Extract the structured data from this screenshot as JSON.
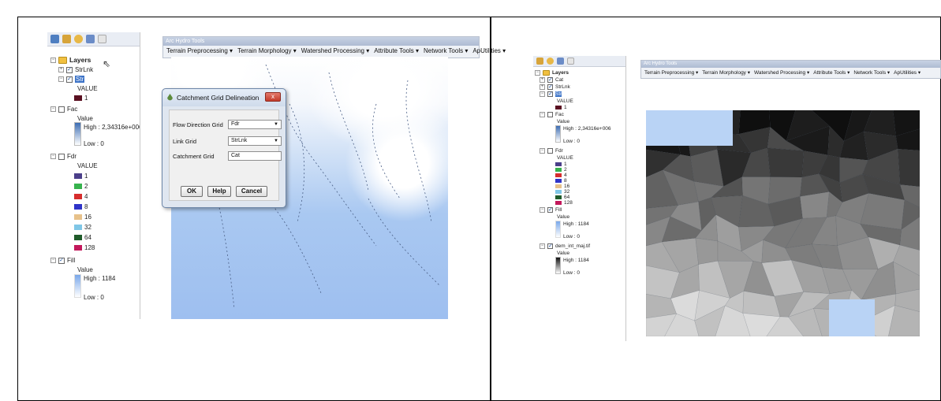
{
  "left": {
    "toc": {
      "root_label": "Layers",
      "layers": [
        {
          "name": "StrLnk",
          "checked": true
        },
        {
          "name": "Str",
          "checked": true,
          "legend_header": "VALUE",
          "items": [
            "1"
          ]
        },
        {
          "name": "Fac",
          "checked": false,
          "legend_header": "Value",
          "high": "High : 2,34316e+006",
          "low": "Low : 0"
        },
        {
          "name": "Fdr",
          "checked": false,
          "legend_header": "VALUE",
          "items": [
            "1",
            "2",
            "4",
            "8",
            "16",
            "32",
            "64",
            "128"
          ]
        },
        {
          "name": "Fill",
          "checked": true,
          "legend_header": "Value",
          "high": "High : 1184",
          "low": "Low : 0"
        }
      ]
    },
    "toolbar": {
      "title": "Arc Hydro Tools",
      "menus": [
        "Terrain Preprocessing ▾",
        "Terrain Morphology ▾",
        "Watershed Processing ▾",
        "Attribute Tools ▾",
        "Network Tools ▾",
        "ApUtilities ▾"
      ]
    },
    "dialog": {
      "title": "Catchment Grid Delineation",
      "close_label": "x",
      "fields": [
        {
          "label": "Flow Direction Grid",
          "value": "Fdr",
          "type": "select"
        },
        {
          "label": "Link Grid",
          "value": "StrLnk",
          "type": "select"
        },
        {
          "label": "Catchment Grid",
          "value": "Cat",
          "type": "input"
        }
      ],
      "buttons": [
        "OK",
        "Help",
        "Cancel"
      ]
    }
  },
  "right": {
    "toc": {
      "root_label": "Layers",
      "layers": [
        {
          "name": "Cat",
          "checked": true
        },
        {
          "name": "StrLnk",
          "checked": true
        },
        {
          "name": "Str",
          "checked": true,
          "legend_header": "VALUE",
          "items": [
            "1"
          ]
        },
        {
          "name": "Fac",
          "checked": false,
          "legend_header": "Value",
          "high": "High : 2,34316e+006",
          "low": "Low : 0"
        },
        {
          "name": "Fdr",
          "checked": false,
          "legend_header": "VALUE",
          "items": [
            "1",
            "2",
            "4",
            "8",
            "16",
            "32",
            "64",
            "128"
          ]
        },
        {
          "name": "Fill",
          "checked": true,
          "legend_header": "Value",
          "high": "High : 1184",
          "low": "Low : 0"
        },
        {
          "name": "dem_int_maj.tif",
          "checked": true,
          "legend_header": "Value",
          "high": "High : 1184",
          "low": "Low : 0"
        }
      ]
    },
    "toolbar": {
      "title": "Arc Hydro Tools",
      "menus": [
        "Terrain Preprocessing ▾",
        "Terrain Morphology ▾",
        "Watershed Processing ▾",
        "Attribute Tools ▾",
        "Network Tools ▾",
        "ApUtilities ▾"
      ]
    }
  },
  "colors": {
    "fdr": [
      "#4b3f8a",
      "#37b24d",
      "#d62d2d",
      "#2f34c8",
      "#e7c18a",
      "#7fc6e6",
      "#1f5b2a",
      "#c2185b"
    ],
    "str": "#5a1021",
    "sea": "#b9d3f5"
  }
}
